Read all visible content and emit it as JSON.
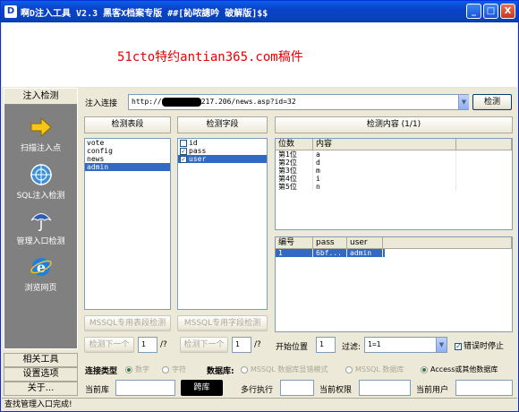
{
  "window": {
    "app_icon_letter": "D",
    "title": "啊D注入工具 V2.3 黑客X档案专版 ##[訫哝謥吟 破解版]$$",
    "minimize_glyph": "_",
    "maximize_glyph": "□",
    "close_glyph": "X"
  },
  "banner": {
    "watermark": "51cto特约antian365.com稿件"
  },
  "sidebar": {
    "header": "注入检测",
    "items": [
      {
        "label": "扫描注入点",
        "icon": "arrow-right-icon"
      },
      {
        "label": "SQL注入检测",
        "icon": "globe-target-icon"
      },
      {
        "label": "管理入口检测",
        "icon": "umbrella-icon"
      },
      {
        "label": "浏览网页",
        "icon": "ie-browser-icon"
      }
    ],
    "footer": [
      "相关工具",
      "设置选项",
      "关于..."
    ]
  },
  "injection": {
    "url_label": "注入连接",
    "url_prefix": "http://",
    "url_suffix": "217.206/news.asp?id=32",
    "detect_button": "检测"
  },
  "tables_panel": {
    "header": "检测表段",
    "items": [
      "vote",
      "config",
      "news",
      "admin"
    ],
    "selected_index": 3,
    "mssql_button": "MSSQL专用表段检测",
    "next_button": "检测下一个",
    "next_value": "1",
    "next_suffix": "/?"
  },
  "fields_panel": {
    "header": "检测字段",
    "items": [
      {
        "name": "id",
        "checked": false
      },
      {
        "name": "pass",
        "checked": true
      },
      {
        "name": "user",
        "checked": true
      }
    ],
    "selected_index": 2,
    "mssql_button": "MSSQL专用字段检测",
    "next_button": "检测下一个",
    "next_value": "1",
    "next_suffix": "/?"
  },
  "content_panel": {
    "header": "检测内容 (1/1)",
    "top_grid": {
      "columns": [
        "位数",
        "内容"
      ],
      "rows": [
        [
          "第1位",
          "a"
        ],
        [
          "第2位",
          "d"
        ],
        [
          "第3位",
          "m"
        ],
        [
          "第4位",
          "i"
        ],
        [
          "第5位",
          "n"
        ]
      ]
    },
    "bottom_grid": {
      "columns": [
        "编号",
        "pass",
        "user"
      ],
      "rows": [
        [
          "1",
          "6bf...",
          "admin"
        ]
      ],
      "selected_index": 0
    },
    "start_label": "开始位置",
    "start_value": "1",
    "filter_label": "过滤:",
    "filter_value": "1=1",
    "stop_on_error_label": "错误时停止",
    "stop_on_error_checked": true
  },
  "connection": {
    "type_label": "连接类型",
    "type_options": [
      {
        "label": "数字",
        "selected": true
      },
      {
        "label": "字符",
        "selected": false
      }
    ],
    "db_label": "数据库:",
    "db_options": [
      {
        "label": "MSSQL 数据库显错模式",
        "selected": false
      },
      {
        "label": "MSSQL 数据库",
        "selected": false
      },
      {
        "label": "Access或其他数据库",
        "selected": true
      }
    ],
    "current_db_label": "当前库",
    "current_db_value": "",
    "black_button": "跨库",
    "multiline_label": "多行执行",
    "multiline_value": "",
    "current_perm_label": "当前权限",
    "current_perm_value": "",
    "current_user_label": "当前用户",
    "current_user_value": ""
  },
  "status": {
    "text": "查找管理入口完成!"
  }
}
